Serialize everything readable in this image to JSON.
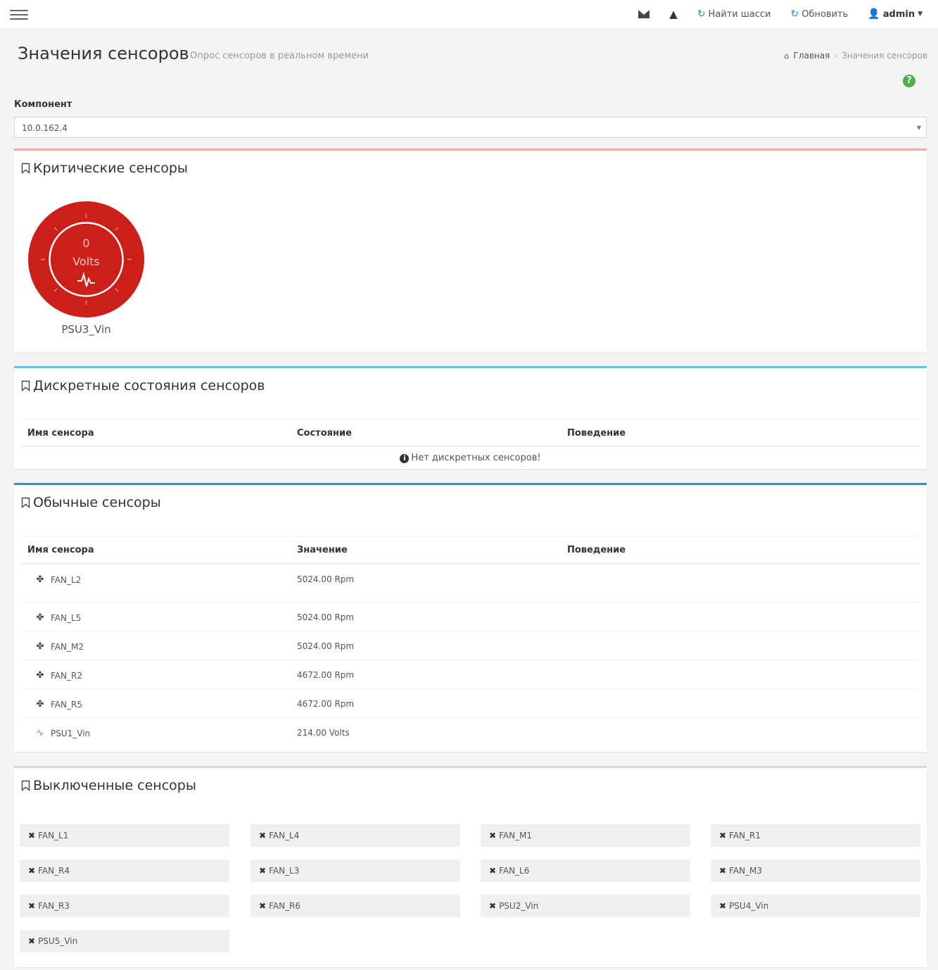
{
  "navbar": {
    "find_chassis": "Найти шасси",
    "refresh": "Обновить",
    "user": "admin"
  },
  "header": {
    "title": "Значения сенсоров",
    "subtitle": "Опрос сенсоров в реальном времени",
    "breadcrumb_home": "Главная",
    "breadcrumb_current": "Значения сенсоров"
  },
  "component": {
    "label": "Компонент",
    "value": "10.0.162.4"
  },
  "critical": {
    "title": "Критические сенсоры",
    "gauge_value": "0",
    "gauge_unit": "Volts",
    "gauge_name": "PSU3_Vin",
    "gauge_color": "#cc1f1a"
  },
  "discrete": {
    "title": "Дискретные состояния сенсоров",
    "col_name": "Имя сенсора",
    "col_state": "Состояние",
    "col_behavior": "Поведение",
    "empty_message": "Нет дискретных сенсоров!"
  },
  "normal": {
    "title": "Обычные сенсоры",
    "col_name": "Имя сенсора",
    "col_value": "Значение",
    "col_behavior": "Поведение",
    "rows": [
      {
        "name": "FAN_L2",
        "value": "5024.00 Rpm",
        "icon": "fan-icon"
      },
      {
        "name": "FAN_L5",
        "value": "5024.00 Rpm",
        "icon": "fan-icon"
      },
      {
        "name": "FAN_M2",
        "value": "5024.00 Rpm",
        "icon": "fan-icon"
      },
      {
        "name": "FAN_R2",
        "value": "4672.00 Rpm",
        "icon": "fan-icon"
      },
      {
        "name": "FAN_R5",
        "value": "4672.00 Rpm",
        "icon": "fan-icon"
      },
      {
        "name": "PSU1_Vin",
        "value": "214.00 Volts",
        "icon": "pulse-icon"
      }
    ]
  },
  "disabled": {
    "title": "Выключенные сенсоры",
    "items": [
      "FAN_L1",
      "FAN_L4",
      "FAN_M1",
      "FAN_R1",
      "FAN_R4",
      "FAN_L3",
      "FAN_L6",
      "FAN_M3",
      "FAN_R3",
      "FAN_R6",
      "PSU2_Vin",
      "PSU4_Vin",
      "PSU5_Vin"
    ]
  },
  "colors": {
    "critical_border": "#f0a9a0",
    "discrete_border": "#5fc7e0",
    "normal_border": "#3c8dbc",
    "refresh_green": "#1aa34a",
    "refresh_blue": "#2a89d6"
  }
}
